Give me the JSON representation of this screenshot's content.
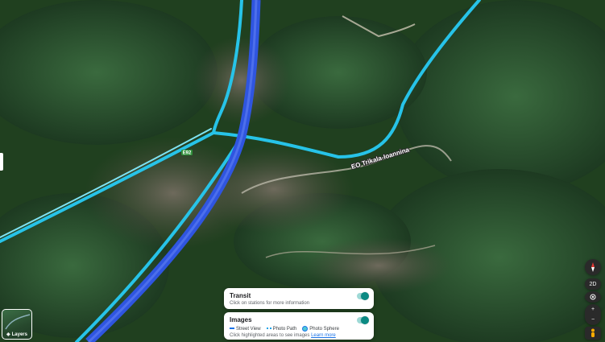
{
  "map": {
    "road_label": "EO Trikala-Ioannina",
    "shield_label": "E92",
    "colors": {
      "forest": "#1f3d23",
      "route_blue": "#2f55e0",
      "street_view": "#27c3e8"
    }
  },
  "transit": {
    "title": "Transit",
    "subtitle": "Click on stations for more information",
    "enabled": true
  },
  "images": {
    "title": "Images",
    "legend_street_view": "Street View",
    "legend_photo_path": "Photo Path",
    "legend_photo_sphere": "Photo Sphere",
    "hint": "Click highlighted areas to see images",
    "learn_more": "Learn more",
    "enabled": true
  },
  "layers": {
    "label": "Layers",
    "icon": "layers-icon"
  },
  "controls": {
    "view_mode": "2D",
    "zoom_in": "+",
    "zoom_out": "−",
    "compass_icon": "compass-icon",
    "location_icon": "my-location-icon",
    "pegman_icon": "pegman-icon"
  }
}
